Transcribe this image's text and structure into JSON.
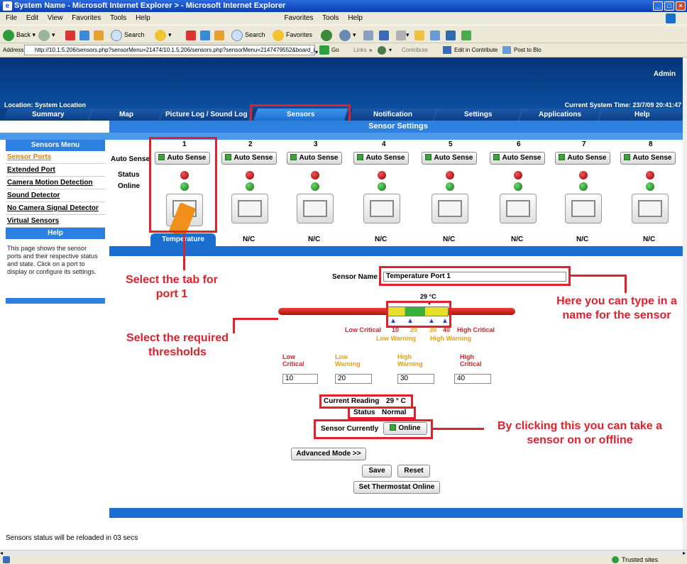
{
  "window": {
    "title": "System Name - Microsoft Internet Explorer     > - Microsoft Internet Explorer"
  },
  "menu": {
    "items": [
      "File",
      "Edit",
      "View",
      "Favorites",
      "Tools",
      "Help"
    ],
    "items2": [
      "Favorites",
      "Tools",
      "Help"
    ]
  },
  "toolbar": {
    "back": "Back",
    "search": "Search",
    "search2": "Search",
    "favorites": "Favorites"
  },
  "address": {
    "label": "Address",
    "url": "http://10.1.5.206/sensors.php?sensorMenu=21474/10.1.5.206/sensors.php?sensorMenu=2147479552&board_id=2147479552&board_index=0&sens",
    "go": "Go",
    "links": "Links",
    "contribute": "Contribute",
    "edit_contribute": "Edit in Contribute",
    "post_blog": "Post to Blo"
  },
  "header": {
    "admin": "Admin",
    "location": "Location: System Location",
    "time": "Current System Time: 23/7/09 20:41:47"
  },
  "nav": {
    "tabs": [
      "Summary",
      "Map",
      "Picture Log / Sound Log",
      "Sensors",
      "Notification",
      "Settings",
      "Applications",
      "Help"
    ]
  },
  "page": {
    "subtitle": "Sensor Settings"
  },
  "sidebar": {
    "menu_title": "Sensors Menu",
    "items": [
      "Sensor Ports",
      "Extended Port",
      "Camera Motion Detection",
      "Sound Detector",
      "No Camera Signal Detector",
      "Virtual Sensors"
    ],
    "help_title": "Help",
    "help_text": "This page shows the sensor ports and their respective status and state. Click on a port to display or configure its settings."
  },
  "ports": {
    "numbers": [
      "1",
      "2",
      "3",
      "4",
      "5",
      "6",
      "7",
      "8"
    ],
    "auto_sense_label": "Auto Sense",
    "row_labels": {
      "auto": "Auto Sense",
      "status": "Status",
      "online": "Online"
    },
    "names": [
      "Temperature",
      "N/C",
      "N/C",
      "N/C",
      "N/C",
      "N/C",
      "N/C",
      "N/C"
    ]
  },
  "sensor": {
    "name_label": "Sensor Name",
    "name_value": "Temperature Port 1",
    "reading_marker": "29 °C",
    "ticks": [
      "10",
      "20",
      "30",
      "40"
    ],
    "low_critical": "Low Critical",
    "high_critical": "High Critical",
    "low_warning": "Low Warning",
    "high_warning": "High Warning",
    "th_labels": {
      "lc1": "Low",
      "lc2": "Critical",
      "lw1": "Low",
      "lw2": "Warning",
      "hw1": "High",
      "hw2": "Warning",
      "hc1": "High",
      "hc2": "Critical"
    },
    "th_values": [
      "10",
      "20",
      "30",
      "40"
    ],
    "current_reading_label": "Current Reading",
    "current_reading_value": "29 ° C",
    "status_label": "Status",
    "status_value": "Normal",
    "currently_label": "Sensor Currently",
    "online_btn": "Online",
    "advanced_btn": "Advanced Mode >>",
    "save_btn": "Save",
    "reset_btn": "Reset",
    "thermostat_btn": "Set Thermostat Online"
  },
  "annotations": {
    "tab": "Select the tab for port 1",
    "thresholds": "Select the required thresholds",
    "name": "Here you can type in a name for the sensor",
    "online": "By clicking this you can take a sensor on or offline"
  },
  "footer": {
    "reload": "Sensors status will be reloaded in 03 secs",
    "zone": "Trusted sites"
  },
  "colors": {
    "annotation": "#e0202a",
    "nav": "#0a3f86",
    "accent": "#1a6ed0",
    "warning": "#f0a000"
  }
}
